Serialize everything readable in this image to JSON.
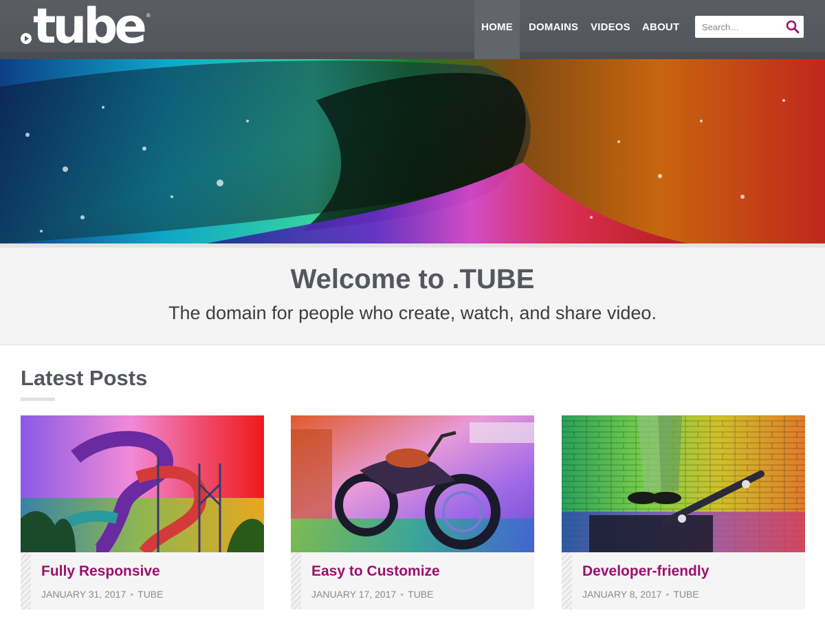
{
  "brand": {
    "logo_text": "tube",
    "accent_color": "#9c0f6e",
    "header_color": "#5a5c63"
  },
  "nav": [
    {
      "label": "HOME",
      "active": true
    },
    {
      "label": "DOMAINS",
      "active": false
    },
    {
      "label": "VIDEOS",
      "active": false
    },
    {
      "label": "ABOUT",
      "active": false
    }
  ],
  "search": {
    "placeholder": "Search…",
    "icon": "search-icon"
  },
  "welcome": {
    "title": "Welcome to .TUBE",
    "subtitle": "The domain for people who create, watch, and share video."
  },
  "latest": {
    "heading": "Latest Posts",
    "posts": [
      {
        "title": "Fully Responsive",
        "date": "JANUARY 31, 2017",
        "author": "TUBE"
      },
      {
        "title": "Easy to Customize",
        "date": "JANUARY 17, 2017",
        "author": "TUBE"
      },
      {
        "title": "Developer-friendly",
        "date": "JANUARY 8, 2017",
        "author": "TUBE"
      }
    ]
  }
}
